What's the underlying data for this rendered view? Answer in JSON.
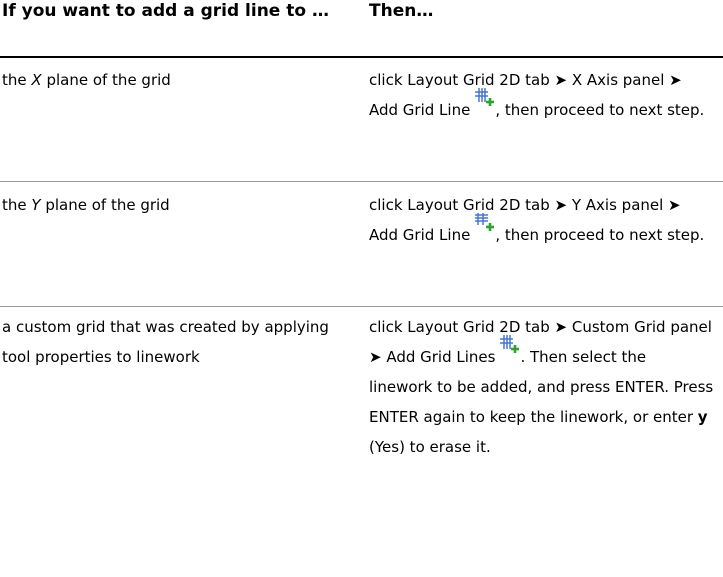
{
  "table": {
    "header": {
      "col1": "If you want to add a grid line to …",
      "col2": "Then…"
    },
    "rows": [
      {
        "left_pre": "the ",
        "left_em": "X",
        "left_post": " plane of the grid",
        "right_text_1": "click Layout Grid 2D tab ➤ X Axis panel ➤ Add Grid Line",
        "right_text_2": ", then proceed to next step.",
        "icon": "add-grid-line-x-icon"
      },
      {
        "left_pre": "the ",
        "left_em": "Y",
        "left_post": " plane of the grid",
        "right_text_1": "click Layout Grid 2D tab ➤ Y Axis panel ➤ Add Grid Line",
        "right_text_2": ", then proceed to next step.",
        "icon": "add-grid-line-y-icon"
      },
      {
        "left_text": "a custom grid that was created by applying tool properties to linework",
        "right_text_1": "click Layout Grid 2D tab ➤ Custom Grid panel ➤ Add Grid Lines",
        "right_text_2": ". Then select the linework to be added, and press ENTER. Press ENTER again to keep the linework, or enter ",
        "right_bold": "y",
        "right_text_3": " (Yes) to erase it.",
        "icon": "add-grid-lines-custom-icon"
      }
    ]
  },
  "colors": {
    "icon_blue": "#3b6fd0",
    "icon_green": "#2aa52a",
    "rule_gray": "#9a9a9a"
  }
}
